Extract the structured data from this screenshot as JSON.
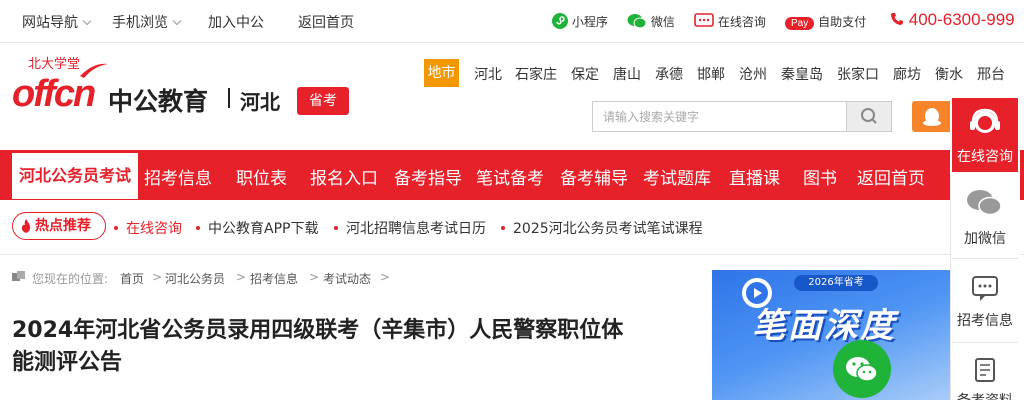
{
  "topbar": {
    "nav_label": "网站导航",
    "mobile_label": "手机浏览",
    "join_label": "加入中公",
    "home_label": "返回首页",
    "miniprogram_label": "小程序",
    "wechat_label": "微信",
    "consult_label": "在线咨询",
    "pay_badge": "Pay",
    "pay_label": "自助支付",
    "phone": "400-6300-999"
  },
  "logo": {
    "top_text": "北大学堂",
    "brand_en": "offcn",
    "brand_cn": "中公教育",
    "province": "河北",
    "badge": "省考"
  },
  "cities": {
    "active": "地市",
    "items": [
      "河北",
      "石家庄",
      "保定",
      "唐山",
      "承德",
      "邯郸",
      "沧州",
      "秦皇岛",
      "张家口",
      "廊坊",
      "衡水",
      "邢台"
    ]
  },
  "search": {
    "placeholder": "请输入搜索关键字"
  },
  "nav": {
    "active": "河北公务员考试",
    "items": [
      "招考信息",
      "职位表",
      "报名入口",
      "备考指导",
      "笔试备考",
      "备考辅导",
      "考试题库",
      "直播课",
      "图书",
      "返回首页"
    ]
  },
  "hot": {
    "badge": "热点推荐",
    "links": [
      "在线咨询",
      "中公教育APP下载",
      "河北招聘信息考试日历",
      "2025河北公务员考试笔试课程"
    ]
  },
  "breadcrumb": {
    "prefix": "您现在的位置:",
    "items": [
      "首页",
      "河北公务员",
      "招考信息",
      "考试动态"
    ],
    "sep": ">"
  },
  "article": {
    "title_line1": "2024年河北省公务员录用四级联考（辛集市）人民警察职位体",
    "title_line2": "能测评公告"
  },
  "banner": {
    "tag": "2026年省考",
    "headline": "笔面深度"
  },
  "rail": {
    "consult": "在线咨询",
    "wechat": "加微信",
    "recruit": "招考信息",
    "materials": "备考资料"
  },
  "colors": {
    "brand_red": "#e6212a",
    "accent_orange": "#f39800",
    "wechat_green": "#1fb339"
  }
}
